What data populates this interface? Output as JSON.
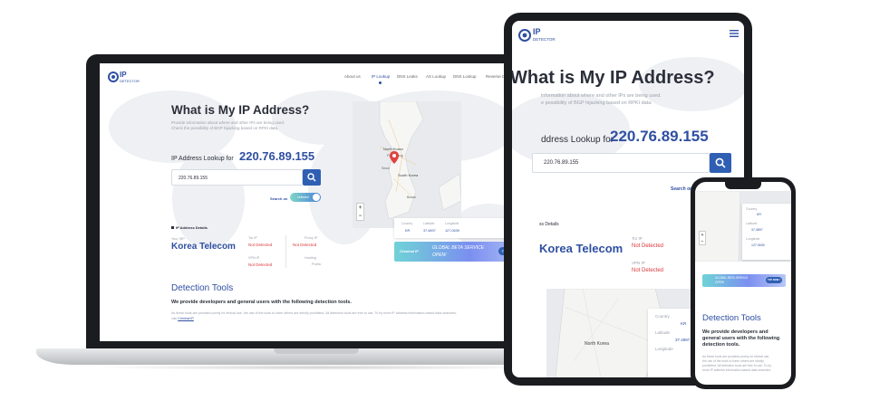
{
  "logo": {
    "text_top": "IP",
    "text_bottom": "DETECTOR"
  },
  "nav": [
    "About us",
    "IP Lookup",
    "DNS Leaks",
    "AS Lookup",
    "DNS Lookup",
    "Reverse DNS Lookup"
  ],
  "hero": {
    "title": "What is My IP Address?",
    "desc_line1": "Provide information about where and other IPs are being used.",
    "desc_line2": "Check the possibility of BGP hijacking based on RPKI data.",
    "tablet_desc_line1": "information about where and other IPs are being used.",
    "tablet_desc_line2": "e possibility of BGP hijacking based on RPKI data.",
    "lookup_label": "IP Address Lookup for",
    "tablet_lookup_label": "ddress Lookup for",
    "ip": "220.76.89.155",
    "search_value": "220.76.89.155",
    "search_on": "Search on",
    "toggle_text": "Unlisted"
  },
  "details": {
    "heading": "IP Address Details",
    "tablet_heading": "ss Details",
    "your_isp": "Your ISP",
    "isp": "Korea Telecom",
    "tor_ip": "Tor IP",
    "tor_val": "Not Detected",
    "proxy_ip": "Proxy IP",
    "proxy_val": "Not Detected",
    "vpn_ip": "VPN IP",
    "vpn_val": "Not Detected",
    "hosting": "Hosting",
    "public": "Public"
  },
  "geo": {
    "country_label": "Country",
    "country": "KR",
    "lat_label": "Latitude",
    "lat": "37.4897",
    "lon_label": "Longitude",
    "lon": "127.0639"
  },
  "map": {
    "north_korea": "North Korea",
    "south_korea": "South Korea",
    "pyongyang": "Pyongyang",
    "seoul": "Seoul",
    "busan": "Busan",
    "zoom_in": "+",
    "zoom_out": "−"
  },
  "banner": {
    "brand": "Criminal IP",
    "text_line1": "GLOBAL BETA SERVICE",
    "text_line2": "OPEN!",
    "button": "TRY NOW !"
  },
  "tools": {
    "title": "Detection Tools",
    "subtitle": "We provide developers and general users with the following detection tools.",
    "body": "As these tools are provided purely for ethical use, the use of the tools to harm others are strictly prohibited. All detection tools are free to use. To try more IP address information-based data searches, visit",
    "link": "Criminal IP",
    "phone_sub_1": "We provide developers and",
    "phone_sub_2": "general users with the following",
    "phone_sub_3": "detection tools.",
    "phone_body_1": "As these tools are provided purely for ethical use,",
    "phone_body_2": "the use of the tools to harm others are strictly",
    "phone_body_3": "prohibited. All detection tools are free to use. To try",
    "phone_body_4": "more IP address information-based data searches."
  },
  "colors": {
    "accent": "#2f4fa2",
    "button": "#2f5fb3",
    "red": "#d9393b"
  }
}
